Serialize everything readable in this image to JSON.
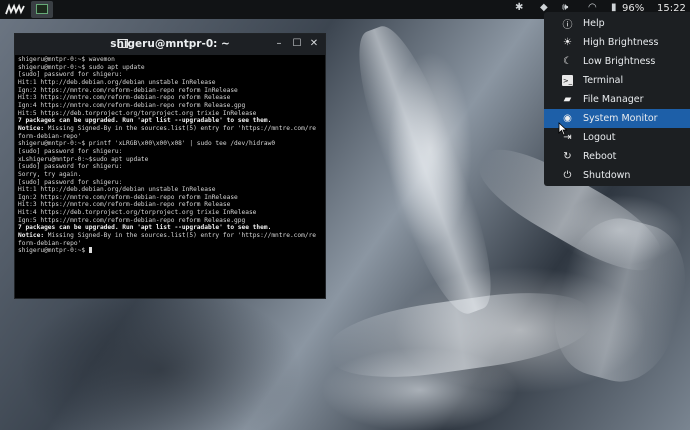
{
  "topbar": {
    "battery": "96%",
    "clock": "15:22"
  },
  "terminal": {
    "title": "shigeru@mntpr-0: ~",
    "lines": [
      {
        "t": "shigeru@mntpr-0:~$ wavemon",
        "b": false
      },
      {
        "t": "shigeru@mntpr-0:~$ sudo apt update",
        "b": false
      },
      {
        "t": "[sudo] password for shigeru:",
        "b": false
      },
      {
        "t": "Hit:1 http://deb.debian.org/debian unstable InRelease",
        "b": false
      },
      {
        "t": "Ign:2 https://mntre.com/reform-debian-repo reform InRelease",
        "b": false
      },
      {
        "t": "Hit:3 https://mntre.com/reform-debian-repo reform Release",
        "b": false
      },
      {
        "t": "Ign:4 https://mntre.com/reform-debian-repo reform Release.gpg",
        "b": false
      },
      {
        "t": "Hit:5 https://deb.torproject.org/torproject.org trixie InRelease",
        "b": false
      },
      {
        "t": "7 packages can be upgraded. Run 'apt list --upgradable' to see them.",
        "b": true
      },
      {
        "t": "Notice: Missing Signed-By in the sources.list(5) entry for 'https://mntre.com/re",
        "b": false,
        "lead": "Notice:"
      },
      {
        "t": "form-debian-repo'",
        "b": false
      },
      {
        "t": "shigeru@mntpr-0:~$ printf 'xLRGB\\x00\\x00\\x08' | sudo tee /dev/hidraw0",
        "b": false
      },
      {
        "t": "[sudo] password for shigeru:",
        "b": false
      },
      {
        "t": "xLshigeru@mntpr-0:~$sudo apt update",
        "b": false
      },
      {
        "t": "[sudo] password for shigeru:",
        "b": false
      },
      {
        "t": "Sorry, try again.",
        "b": false
      },
      {
        "t": "[sudo] password for shigeru:",
        "b": false
      },
      {
        "t": "Hit:1 http://deb.debian.org/debian unstable InRelease",
        "b": false
      },
      {
        "t": "Ign:2 https://mntre.com/reform-debian-repo reform InRelease",
        "b": false
      },
      {
        "t": "Hit:3 https://mntre.com/reform-debian-repo reform Release",
        "b": false
      },
      {
        "t": "Hit:4 https://deb.torproject.org/torproject.org trixie InRelease",
        "b": false
      },
      {
        "t": "Ign:5 https://mntre.com/reform-debian-repo reform Release.gpg",
        "b": false
      },
      {
        "t": "7 packages can be upgraded. Run 'apt list --upgradable' to see them.",
        "b": true
      },
      {
        "t": "Notice: Missing Signed-By in the sources.list(5) entry for 'https://mntre.com/re",
        "b": false,
        "lead": "Notice:"
      },
      {
        "t": "form-debian-repo'",
        "b": false
      },
      {
        "t": "shigeru@mntpr-0:~$ ",
        "b": false,
        "cursor": true
      }
    ]
  },
  "menu": {
    "items": [
      {
        "label": "Help",
        "icon": "info-icon"
      },
      {
        "label": "High Brightness",
        "icon": "sun-icon"
      },
      {
        "label": "Low Brightness",
        "icon": "moon-icon"
      },
      {
        "label": "Terminal",
        "icon": "terminal-icon"
      },
      {
        "label": "File Manager",
        "icon": "folder-icon"
      },
      {
        "label": "System Monitor",
        "icon": "monitor-icon",
        "selected": true
      },
      {
        "label": "Logout",
        "icon": "logout-icon"
      },
      {
        "label": "Reboot",
        "icon": "reboot-icon"
      },
      {
        "label": "Shutdown",
        "icon": "power-icon"
      }
    ]
  },
  "colors": {
    "menu_selected": "#1d5fa8",
    "topbar": "#111315"
  }
}
